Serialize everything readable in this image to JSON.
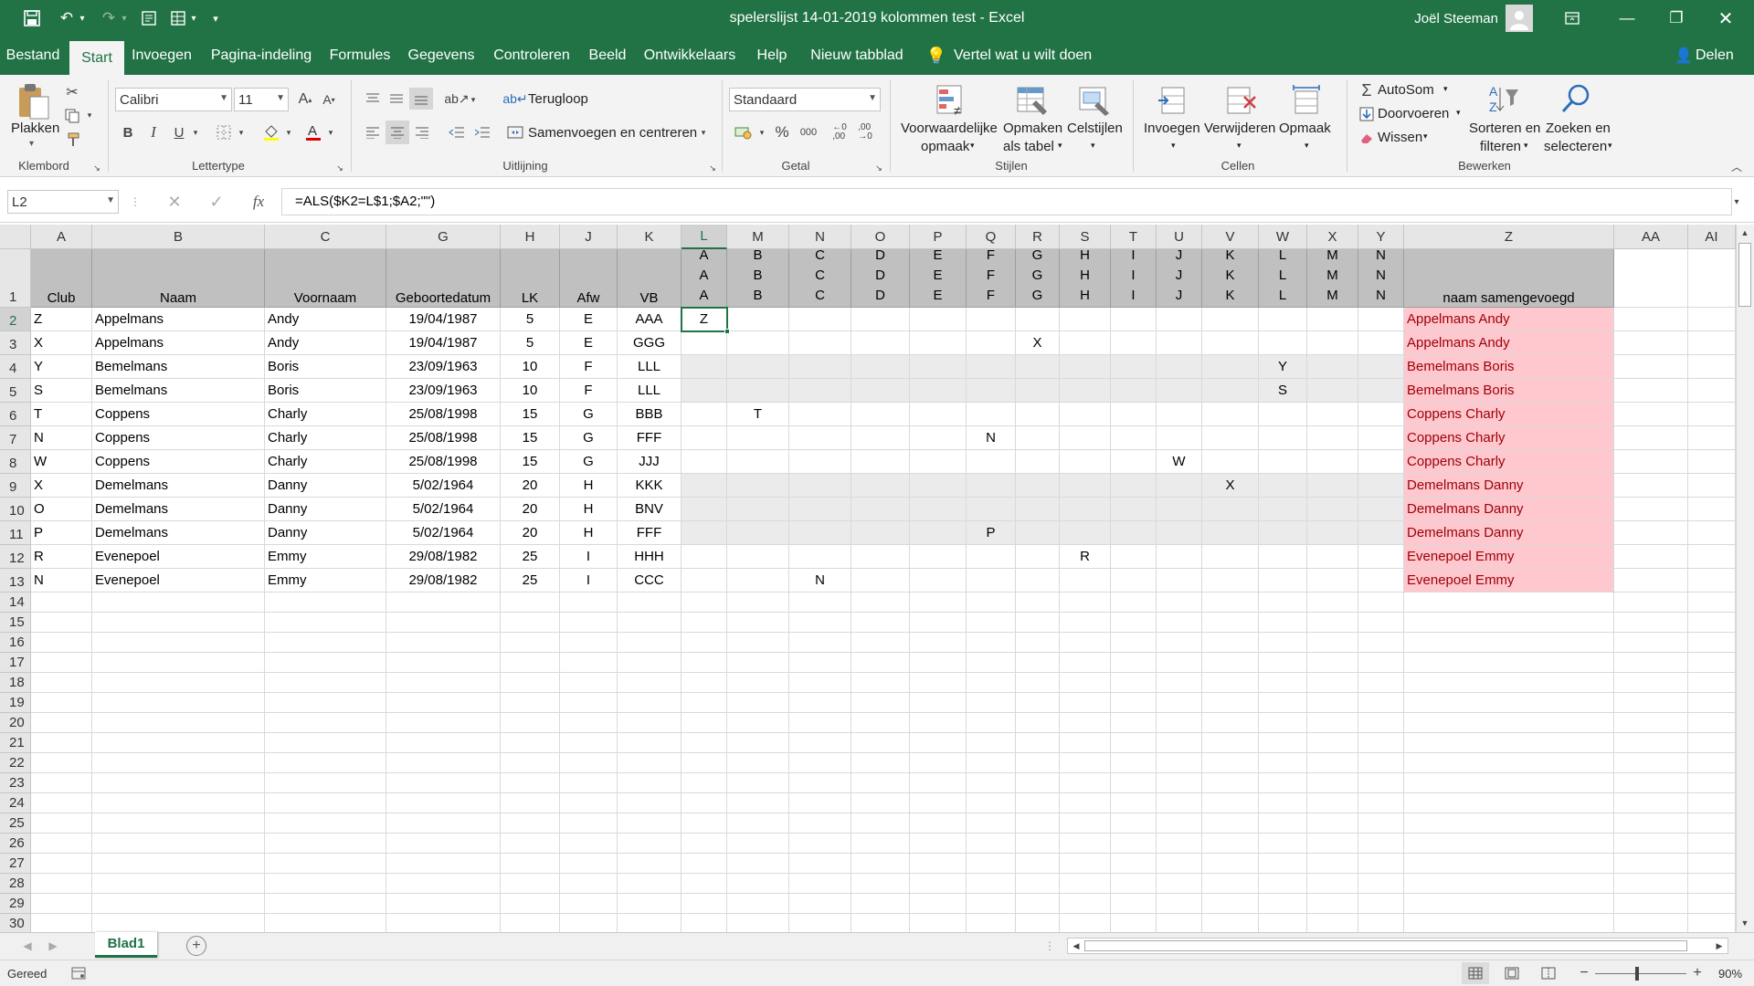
{
  "app": {
    "window_title": "spelerslijst 14-01-2019 kolommen test  -  Excel",
    "user": "Joël Steeman"
  },
  "tabs": [
    "Bestand",
    "Start",
    "Invoegen",
    "Pagina-indeling",
    "Formules",
    "Gegevens",
    "Controleren",
    "Beeld",
    "Ontwikkelaars",
    "Help",
    "Nieuw tabblad"
  ],
  "tell_me": "Vertel wat u wilt doen",
  "share": "Delen",
  "ribbon": {
    "clipboard": {
      "paste": "Plakken",
      "group": "Klembord"
    },
    "font": {
      "name": "Calibri",
      "size": "11",
      "group": "Lettertype",
      "bold": "B",
      "italic": "I",
      "underline": "U"
    },
    "alignment": {
      "wrap": "Terugloop",
      "merge": "Samenvoegen en centreren",
      "group": "Uitlijning"
    },
    "number": {
      "format": "Standaard",
      "group": "Getal",
      "percent": "%",
      "thousands": "000"
    },
    "styles": {
      "conditional1": "Voorwaardelijke",
      "conditional2": "opmaak",
      "table1": "Opmaken",
      "table2": "als tabel",
      "cellstyles": "Celstijlen",
      "group": "Stijlen"
    },
    "cells": {
      "insert": "Invoegen",
      "delete": "Verwijderen",
      "format": "Opmaak",
      "group": "Cellen"
    },
    "editing": {
      "autosum": "AutoSom",
      "fill": "Doorvoeren",
      "clear": "Wissen",
      "sort1": "Sorteren en",
      "sort2": "filteren",
      "find1": "Zoeken en",
      "find2": "selecteren",
      "group": "Bewerken"
    }
  },
  "formula_bar": {
    "name_box": "L2",
    "fx": "fx",
    "formula": "=ALS($K2=L$1;$A2;\"\")"
  },
  "columns": [
    "A",
    "B",
    "C",
    "G",
    "H",
    "J",
    "K",
    "L",
    "M",
    "N",
    "O",
    "P",
    "Q",
    "R",
    "S",
    "T",
    "U",
    "V",
    "W",
    "X",
    "Y",
    "Z",
    "AA",
    "AI"
  ],
  "header_row": {
    "A": "Club",
    "B": "Naam",
    "C": "Voornaam",
    "G": "Geboortedatum",
    "H": "LK",
    "J": "Afw",
    "K": "VB",
    "stacked": {
      "L": [
        "A",
        "A",
        "A"
      ],
      "M": [
        "B",
        "B",
        "B"
      ],
      "N": [
        "C",
        "C",
        "C"
      ],
      "O": [
        "D",
        "D",
        "D"
      ],
      "P": [
        "E",
        "E",
        "E"
      ],
      "Q": [
        "F",
        "F",
        "F"
      ],
      "R": [
        "G",
        "G",
        "G"
      ],
      "S": [
        "H",
        "H",
        "H"
      ],
      "T": [
        "I",
        "I",
        "I"
      ],
      "U": [
        "J",
        "J",
        "J"
      ],
      "V": [
        "K",
        "K",
        "K"
      ],
      "W": [
        "L",
        "L",
        "L"
      ],
      "X": [
        "M",
        "M",
        "M"
      ],
      "Y": [
        "N",
        "N",
        "N"
      ]
    },
    "Z": "naam samengevoegd"
  },
  "rows": [
    {
      "n": "2",
      "A": "Z",
      "B": "Appelmans",
      "C": "Andy",
      "G": "19/04/1987",
      "H": "5",
      "J": "E",
      "K": "AAA",
      "mark_col": "L",
      "mark": "Z",
      "Z": "Appelmans Andy",
      "band": false
    },
    {
      "n": "3",
      "A": "X",
      "B": "Appelmans",
      "C": "Andy",
      "G": "19/04/1987",
      "H": "5",
      "J": "E",
      "K": "GGG",
      "mark_col": "R",
      "mark": "X",
      "Z": "Appelmans Andy",
      "band": false
    },
    {
      "n": "4",
      "A": "Y",
      "B": "Bemelmans",
      "C": "Boris",
      "G": "23/09/1963",
      "H": "10",
      "J": "F",
      "K": "LLL",
      "mark_col": "W",
      "mark": "Y",
      "Z": "Bemelmans Boris",
      "band": true
    },
    {
      "n": "5",
      "A": "S",
      "B": "Bemelmans",
      "C": "Boris",
      "G": "23/09/1963",
      "H": "10",
      "J": "F",
      "K": "LLL",
      "mark_col": "W",
      "mark": "S",
      "Z": "Bemelmans Boris",
      "band": true
    },
    {
      "n": "6",
      "A": "T",
      "B": "Coppens",
      "C": "Charly",
      "G": "25/08/1998",
      "H": "15",
      "J": "G",
      "K": "BBB",
      "mark_col": "M",
      "mark": "T",
      "Z": "Coppens Charly",
      "band": false
    },
    {
      "n": "7",
      "A": "N",
      "B": "Coppens",
      "C": "Charly",
      "G": "25/08/1998",
      "H": "15",
      "J": "G",
      "K": "FFF",
      "mark_col": "Q",
      "mark": "N",
      "Z": "Coppens Charly",
      "band": false
    },
    {
      "n": "8",
      "A": "W",
      "B": "Coppens",
      "C": "Charly",
      "G": "25/08/1998",
      "H": "15",
      "J": "G",
      "K": "JJJ",
      "mark_col": "U",
      "mark": "W",
      "Z": "Coppens Charly",
      "band": false
    },
    {
      "n": "9",
      "A": "X",
      "B": "Demelmans",
      "C": "Danny",
      "G": "5/02/1964",
      "H": "20",
      "J": "H",
      "K": "KKK",
      "mark_col": "V",
      "mark": "X",
      "Z": "Demelmans Danny",
      "band": true
    },
    {
      "n": "10",
      "A": "O",
      "B": "Demelmans",
      "C": "Danny",
      "G": "5/02/1964",
      "H": "20",
      "J": "H",
      "K": "BNV",
      "mark_col": "",
      "mark": "",
      "Z": "Demelmans Danny",
      "band": true
    },
    {
      "n": "11",
      "A": "P",
      "B": "Demelmans",
      "C": "Danny",
      "G": "5/02/1964",
      "H": "20",
      "J": "H",
      "K": "FFF",
      "mark_col": "Q",
      "mark": "P",
      "Z": "Demelmans Danny",
      "band": true
    },
    {
      "n": "12",
      "A": "R",
      "B": "Evenepoel",
      "C": "Emmy",
      "G": "29/08/1982",
      "H": "25",
      "J": "I",
      "K": "HHH",
      "mark_col": "S",
      "mark": "R",
      "Z": "Evenepoel Emmy",
      "band": false
    },
    {
      "n": "13",
      "A": "N",
      "B": "Evenepoel",
      "C": "Emmy",
      "G": "29/08/1982",
      "H": "25",
      "J": "I",
      "K": "CCC",
      "mark_col": "N",
      "mark": "N",
      "Z": "Evenepoel Emmy",
      "band": false
    }
  ],
  "empty_rows": [
    "14",
    "15",
    "16",
    "17",
    "18",
    "19",
    "20",
    "21",
    "22",
    "23",
    "24",
    "25",
    "26",
    "27",
    "28",
    "29",
    "30"
  ],
  "sheet": {
    "name": "Blad1"
  },
  "status": {
    "ready": "Gereed",
    "zoom": "90%"
  },
  "colors": {
    "excel_green": "#217346",
    "pink_fill": "#ffc7ce",
    "pink_text": "#9c0006",
    "header_gray": "#c0c0c0",
    "band_gray": "#ebebeb"
  }
}
